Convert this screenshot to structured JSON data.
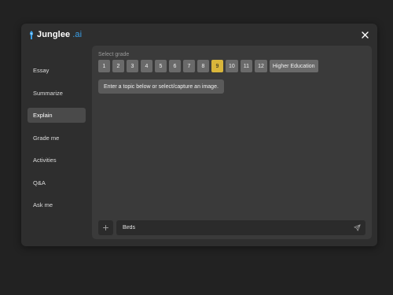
{
  "brand": {
    "name": "Junglee",
    "accent_text": ".ai",
    "accent_color": "#3aa0e8",
    "icon": "junglee-logo-icon"
  },
  "close": {
    "icon": "close-icon"
  },
  "sidebar": {
    "items": [
      {
        "label": "Essay",
        "active": false
      },
      {
        "label": "Summarize",
        "active": false
      },
      {
        "label": "Explain",
        "active": true
      },
      {
        "label": "Grade me",
        "active": false
      },
      {
        "label": "Activities",
        "active": false
      },
      {
        "label": "Q&A",
        "active": false
      },
      {
        "label": "Ask me",
        "active": false
      }
    ]
  },
  "grade_selector": {
    "label": "Select grade",
    "options": [
      "1",
      "2",
      "3",
      "4",
      "5",
      "6",
      "7",
      "8",
      "9",
      "10",
      "11",
      "12",
      "Higher Education"
    ],
    "selected": "9",
    "selected_color": "#d9b63b"
  },
  "hint": {
    "text": "Enter a topic below or select/capture an image."
  },
  "input": {
    "value": "Birds",
    "add_icon": "plus-icon",
    "send_icon": "send-icon"
  }
}
